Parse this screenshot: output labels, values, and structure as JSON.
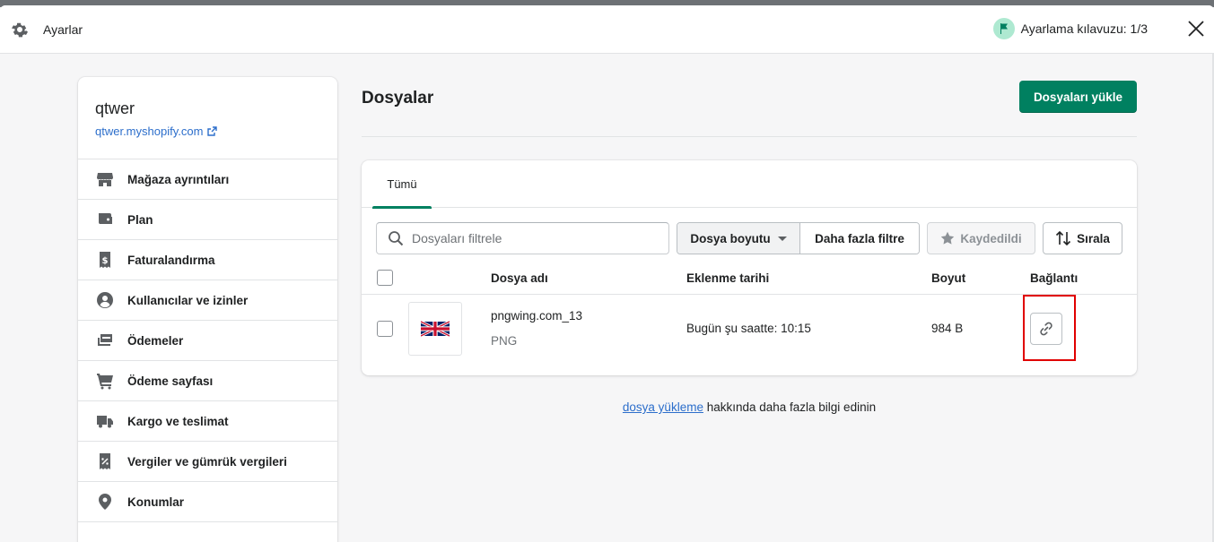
{
  "window": {
    "title": "Ayarlar",
    "guide_label": "Ayarlama kılavuzu: 1/3"
  },
  "store": {
    "name": "qtwer",
    "domain": "qtwer.myshopify.com"
  },
  "sidebar": {
    "items": [
      {
        "label": "Mağaza ayrıntıları",
        "icon": "store-icon"
      },
      {
        "label": "Plan",
        "icon": "plan-icon"
      },
      {
        "label": "Faturalandırma",
        "icon": "billing-icon"
      },
      {
        "label": "Kullanıcılar ve izinler",
        "icon": "user-icon"
      },
      {
        "label": "Ödemeler",
        "icon": "payments-icon"
      },
      {
        "label": "Ödeme sayfası",
        "icon": "cart-icon"
      },
      {
        "label": "Kargo ve teslimat",
        "icon": "truck-icon"
      },
      {
        "label": "Vergiler ve gümrük vergileri",
        "icon": "tax-icon"
      },
      {
        "label": "Konumlar",
        "icon": "location-icon"
      }
    ]
  },
  "page": {
    "title": "Dosyalar",
    "upload_label": "Dosyaları yükle"
  },
  "tabs": [
    {
      "label": "Tümü",
      "selected": true
    }
  ],
  "filters": {
    "search_placeholder": "Dosyaları filtrele",
    "file_size_label": "Dosya boyutu",
    "more_filters_label": "Daha fazla filtre",
    "saved_label": "Kaydedildi",
    "sort_label": "Sırala"
  },
  "table": {
    "headers": {
      "name": "Dosya adı",
      "date": "Eklenme tarihi",
      "size": "Boyut",
      "link": "Bağlantı"
    },
    "rows": [
      {
        "name": "pngwing.com_13",
        "type": "PNG",
        "date": "Bugün şu saatte: 10:15",
        "size": "984 B",
        "thumbnail_icon": "uk-flag-icon"
      }
    ]
  },
  "footer": {
    "link_text": "dosya yükleme",
    "rest_text": " hakkında daha fazla bilgi edinin"
  },
  "colors": {
    "primary": "#008060",
    "link": "#2c6ecb",
    "highlight": "#e00000"
  }
}
